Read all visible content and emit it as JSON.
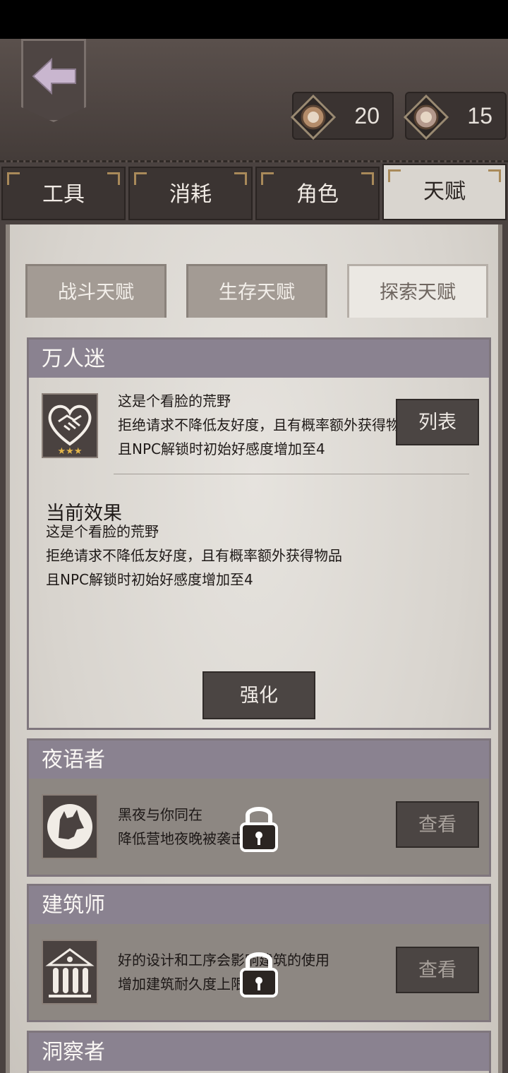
{
  "currencies": [
    {
      "value": "20",
      "icon": "coin-icon"
    },
    {
      "value": "15",
      "icon": "gem-icon"
    }
  ],
  "tabs": [
    {
      "label": "工具"
    },
    {
      "label": "消耗"
    },
    {
      "label": "角色"
    },
    {
      "label": "天赋",
      "active": true
    }
  ],
  "subtabs": [
    {
      "label": "战斗天赋"
    },
    {
      "label": "生存天赋"
    },
    {
      "label": "探索天赋",
      "active": true
    }
  ],
  "talents": [
    {
      "name": "万人迷",
      "icon": "handshake-heart-icon",
      "stars": "★★★",
      "desc": [
        "这是个看脸的荒野",
        "拒绝请求不降低友好度，且有概率额外获得物",
        "且NPC解锁时初始好感度增加至4"
      ],
      "button": "列表",
      "effect_title": "当前效果",
      "effect": [
        "这是个看脸的荒野",
        "拒绝请求不降低友好度，且有概率额外获得物品",
        "且NPC解锁时初始好感度增加至4"
      ],
      "enhance": "强化"
    },
    {
      "name": "夜语者",
      "icon": "wolf-icon",
      "desc": [
        "黑夜与你同在",
        "降低营地夜晚被袭击"
      ],
      "button": "查看",
      "locked": true
    },
    {
      "name": "建筑师",
      "icon": "building-icon",
      "desc": [
        "好的设计和工序会影响建筑的使用",
        "增加建筑耐久度上限"
      ],
      "button": "查看",
      "locked": true
    },
    {
      "name": "洞察者"
    }
  ]
}
